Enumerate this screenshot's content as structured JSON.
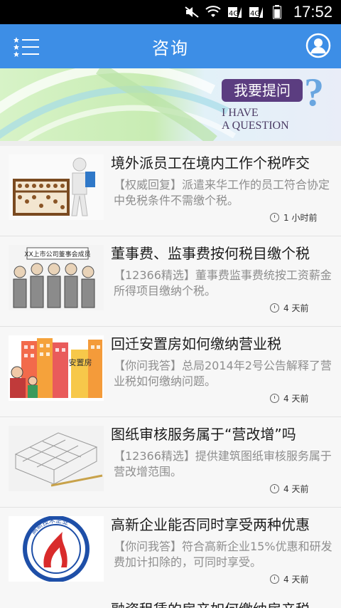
{
  "status_bar": {
    "time": "17:52",
    "icons": [
      "mute-icon",
      "wifi-icon",
      "sim1-icon",
      "sim2-icon",
      "battery-icon"
    ]
  },
  "app_bar": {
    "title": "咨询",
    "menu_icon": "list-menu-icon",
    "profile_icon": "user-profile-icon",
    "color": "#3d8ee6"
  },
  "banner": {
    "tag": "我要提问",
    "english_line1": "I HAVE",
    "english_line2": "A QUESTION",
    "question_mark": "?"
  },
  "news": [
    {
      "title": "境外派员工在境内工作个税咋交",
      "summary": "【权威回复】派遣来华工作的员工符合协定中免税条件不需缴个税。",
      "time": "1 小时前",
      "thumb": "abacus-figure"
    },
    {
      "title": "董事费、监事费按何税目缴个税",
      "summary": "【12366精选】董事费监事费统按工资薪金所得项目缴纳个税。",
      "time": "4 天前",
      "thumb": "board-members",
      "thumb_sign": "XX上市公司董事会成员"
    },
    {
      "title": "回迁安置房如何缴纳营业税",
      "summary": "【你问我答】总局2014年2号公告解释了营业税如何缴纳问题。",
      "time": "4 天前",
      "thumb": "resettlement-buildings",
      "thumb_sign": "安置房"
    },
    {
      "title": "图纸审核服务属于“营改增”吗",
      "summary": "【12366精选】提供建筑图纸审核服务属于营改增范围。",
      "time": "4 天前",
      "thumb": "blueprint-sketch"
    },
    {
      "title": "高新企业能否同时享受两种优惠",
      "summary": "【你问我答】符合高新企业15%优惠和研发费加计扣除的，可同时享受。",
      "time": "4 天前",
      "thumb": "hi-tech-badge",
      "thumb_sign_top": "高新技术企业"
    }
  ],
  "partial_item_title": "融资租赁的房产如何缴纳房产税"
}
